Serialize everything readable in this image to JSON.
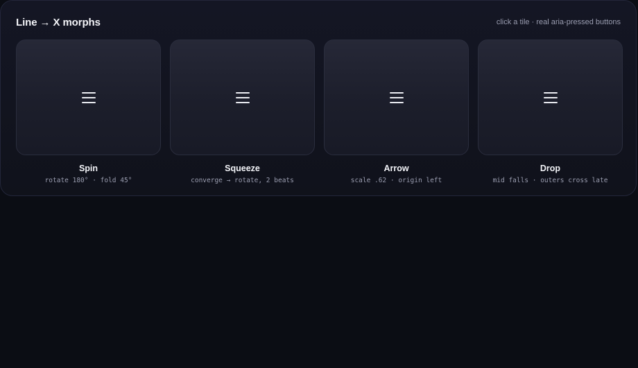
{
  "header": {
    "title": "Line → X morphs",
    "hint": "click a tile · real aria-pressed buttons"
  },
  "tiles": [
    {
      "name": "Spin",
      "desc": "rotate 180° · fold 45°",
      "icon": "hamburger-icon",
      "pressed": false
    },
    {
      "name": "Squeeze",
      "desc": "converge → rotate, 2 beats",
      "icon": "hamburger-icon",
      "pressed": false
    },
    {
      "name": "Arrow",
      "desc": "scale .62 · origin left",
      "icon": "hamburger-icon",
      "pressed": false
    },
    {
      "name": "Drop",
      "desc": "mid falls · outers cross late",
      "icon": "hamburger-icon",
      "pressed": false
    }
  ]
}
